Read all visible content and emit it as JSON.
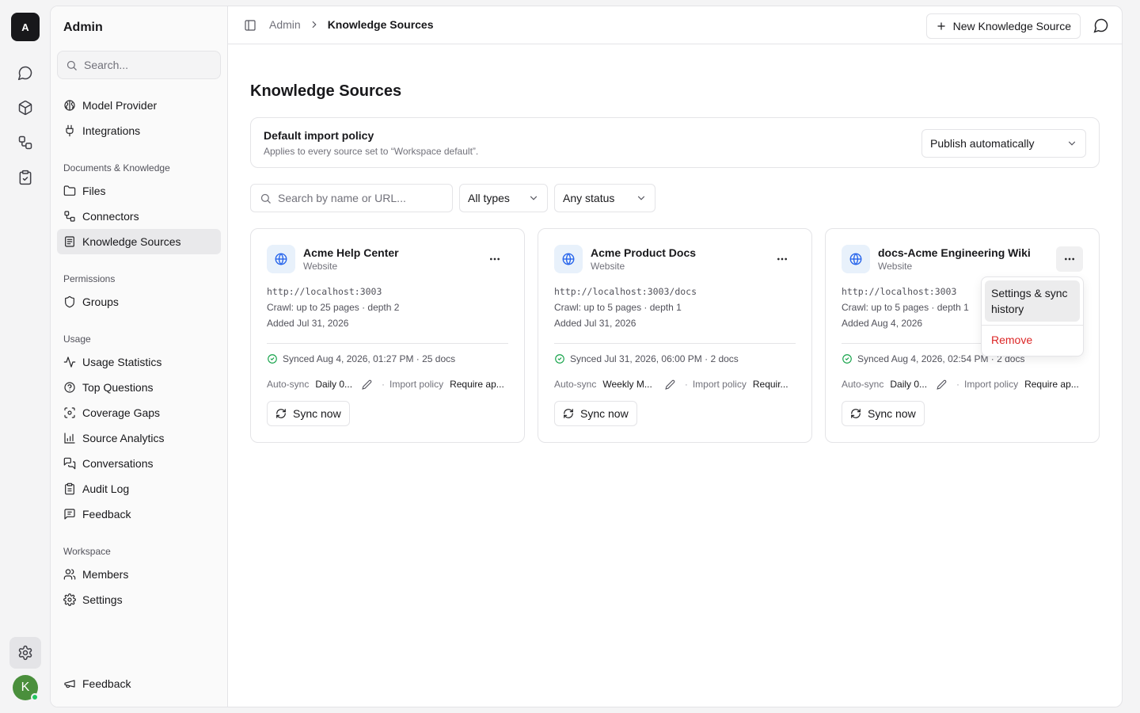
{
  "rail": {
    "logo_letter": "A",
    "avatar_letter": "K"
  },
  "sidebar": {
    "title": "Admin",
    "search_placeholder": "Search...",
    "top_items": [
      {
        "label": "Model Provider",
        "icon": "brain-icon"
      },
      {
        "label": "Integrations",
        "icon": "plug-icon"
      }
    ],
    "sections": [
      {
        "title": "Documents & Knowledge",
        "items": [
          {
            "label": "Files",
            "icon": "folder-icon"
          },
          {
            "label": "Connectors",
            "icon": "connector-icon"
          },
          {
            "label": "Knowledge Sources",
            "icon": "book-icon",
            "active": true
          }
        ]
      },
      {
        "title": "Permissions",
        "items": [
          {
            "label": "Groups",
            "icon": "shield-icon"
          }
        ]
      },
      {
        "title": "Usage",
        "items": [
          {
            "label": "Usage Statistics",
            "icon": "activity-icon"
          },
          {
            "label": "Top Questions",
            "icon": "help-circle-icon"
          },
          {
            "label": "Coverage Gaps",
            "icon": "scan-icon"
          },
          {
            "label": "Source Analytics",
            "icon": "bar-chart-icon"
          },
          {
            "label": "Conversations",
            "icon": "messages-icon"
          },
          {
            "label": "Audit Log",
            "icon": "clipboard-icon"
          },
          {
            "label": "Feedback",
            "icon": "message-square-icon"
          }
        ]
      },
      {
        "title": "Workspace",
        "items": [
          {
            "label": "Members",
            "icon": "users-icon"
          },
          {
            "label": "Settings",
            "icon": "gear-icon"
          }
        ]
      }
    ],
    "footer_label": "Feedback"
  },
  "topbar": {
    "breadcrumb_root": "Admin",
    "breadcrumb_current": "Knowledge Sources",
    "new_button_label": "New Knowledge Source"
  },
  "main": {
    "title": "Knowledge Sources",
    "policy": {
      "title": "Default import policy",
      "description": "Applies to every source set to “Workspace default”.",
      "selected": "Publish automatically"
    },
    "filters": {
      "search_placeholder": "Search by name or URL...",
      "type_selected": "All types",
      "status_selected": "Any status"
    },
    "cards": [
      {
        "name": "Acme Help Center",
        "type": "Website",
        "url": "http://localhost:3003",
        "crawl": "Crawl: up to 25 pages · depth 2",
        "added": "Added Jul 31, 2026",
        "synced": "Synced Aug 4, 2026, 01:27 PM · 25 docs",
        "auto_sync_label": "Auto-sync",
        "auto_sync_value": "Daily 0...",
        "import_policy_label": "Import policy",
        "import_policy_value": "Require ap...",
        "sync_button": "Sync now"
      },
      {
        "name": "Acme Product Docs",
        "type": "Website",
        "url": "http://localhost:3003/docs",
        "crawl": "Crawl: up to 5 pages · depth 1",
        "added": "Added Jul 31, 2026",
        "synced": "Synced Jul 31, 2026, 06:00 PM · 2 docs",
        "auto_sync_label": "Auto-sync",
        "auto_sync_value": "Weekly M...",
        "import_policy_label": "Import policy",
        "import_policy_value": "Requir...",
        "sync_button": "Sync now"
      },
      {
        "name": "docs-Acme Engineering Wiki",
        "type": "Website",
        "url": "http://localhost:3003",
        "crawl": "Crawl: up to 5 pages · depth 1",
        "added": "Added Aug 4, 2026",
        "synced": "Synced Aug 4, 2026, 02:54 PM · 2 docs",
        "auto_sync_label": "Auto-sync",
        "auto_sync_value": "Daily 0...",
        "import_policy_label": "Import policy",
        "import_policy_value": "Require ap...",
        "sync_button": "Sync now"
      }
    ],
    "card_menu": {
      "settings_label": "Settings & sync history",
      "remove_label": "Remove"
    }
  },
  "colors": {
    "accent_blue": "#2563eb",
    "success_green": "#16a34a",
    "danger_red": "#dc2626",
    "avatar_green": "#4a8f3c"
  }
}
